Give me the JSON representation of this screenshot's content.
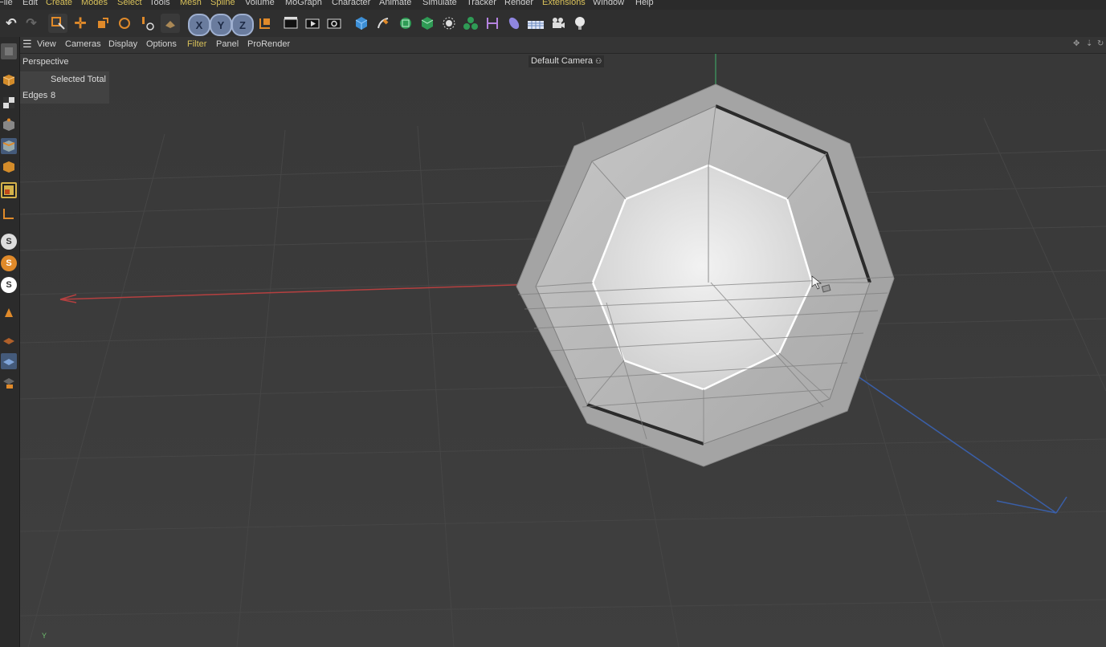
{
  "menu": [
    "File",
    "Edit",
    "Create",
    "Modes",
    "Select",
    "Tools",
    "Mesh",
    "Spline",
    "Volume",
    "MoGraph",
    "Character",
    "Animate",
    "Simulate",
    "Tracker",
    "Render",
    "Extensions",
    "Window",
    "Help"
  ],
  "toolbar": {
    "axis_x": "X",
    "axis_y": "Y",
    "axis_z": "Z"
  },
  "leftbar": {
    "snap1": "S",
    "snap2": "S",
    "snap3": "S"
  },
  "viewport_menu": [
    "View",
    "Cameras",
    "Display",
    "Options",
    "Filter",
    "Panel",
    "ProRender"
  ],
  "viewport": {
    "name": "Perspective",
    "camera": "Default Camera",
    "hud_header": "Selected Total",
    "hud_row_label": "Edges",
    "hud_row_value": "8",
    "axis_label": "Y"
  },
  "colors": {
    "menu_highlight": "#d8c15a",
    "axis_x": "#c0392b",
    "axis_y": "#3faa55",
    "axis_z": "#3a66c4",
    "selection": "#ffffff"
  }
}
